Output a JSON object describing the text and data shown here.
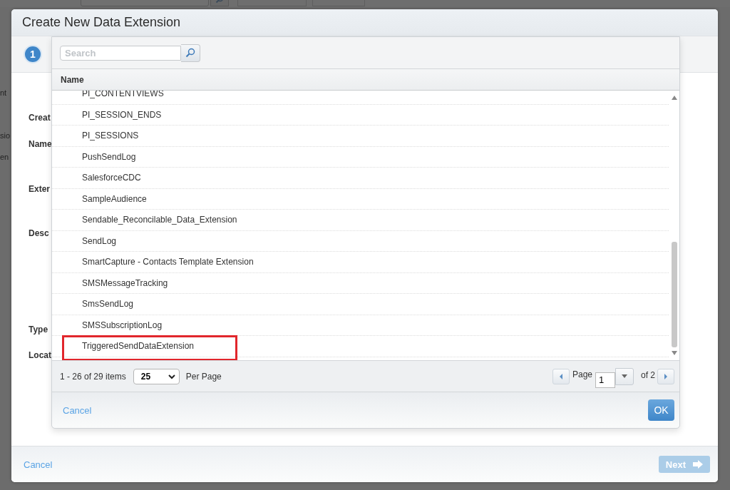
{
  "background": {
    "sidebar_fragments": [
      "nt",
      "sio",
      "en"
    ]
  },
  "dialog": {
    "title": "Create New Data Extension",
    "step": {
      "number": "1"
    },
    "field_labels": [
      "Creat",
      "Name",
      "Exter",
      "Desc",
      "Type",
      "Locat"
    ],
    "footer": {
      "cancel": "Cancel",
      "next": {
        "label": "Next",
        "disabled": true
      }
    }
  },
  "picker": {
    "search": {
      "placeholder": "Search"
    },
    "column": "Name",
    "rows": [
      {
        "name": "PI_CONTENTVIEWS",
        "highlighted": false
      },
      {
        "name": "PI_SESSION_ENDS",
        "highlighted": false
      },
      {
        "name": "PI_SESSIONS",
        "highlighted": false
      },
      {
        "name": "PushSendLog",
        "highlighted": false
      },
      {
        "name": "SalesforceCDC",
        "highlighted": false
      },
      {
        "name": "SampleAudience",
        "highlighted": false
      },
      {
        "name": "Sendable_Reconcilable_Data_Extension",
        "highlighted": false
      },
      {
        "name": "SendLog",
        "highlighted": false
      },
      {
        "name": "SmartCapture - Contacts Template Extension",
        "highlighted": false
      },
      {
        "name": "SMSMessageTracking",
        "highlighted": false
      },
      {
        "name": "SmsSendLog",
        "highlighted": false
      },
      {
        "name": "SMSSubscriptionLog",
        "highlighted": false
      },
      {
        "name": "TriggeredSendDataExtension",
        "highlighted": true
      }
    ],
    "pager": {
      "summary": "1 - 26 of 29 items",
      "per_page": "25",
      "per_page_label": "Per Page",
      "page_label": "Page",
      "page": "1",
      "of": "of 2"
    },
    "cancel": "Cancel",
    "ok": "OK"
  }
}
